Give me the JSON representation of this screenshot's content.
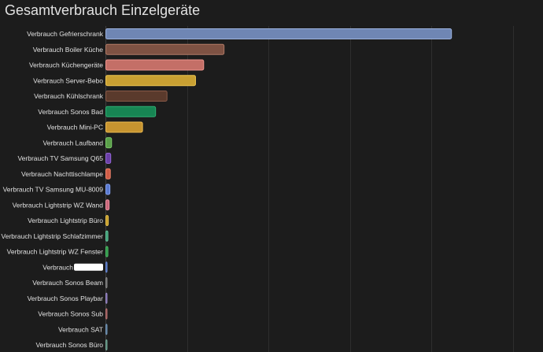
{
  "chart_data": {
    "type": "bar",
    "orientation": "horizontal",
    "title": "Gesamtverbrauch Einzelgeräte",
    "xlabel": "",
    "ylabel": "",
    "xlim": [
      0,
      53
    ],
    "grid": true,
    "legend": "none",
    "categories": [
      "Verbrauch Gefrierschrank",
      "Verbrauch Boiler Küche",
      "Verbrauch Küchengeräte",
      "Verbrauch Server-Bebo",
      "Verbrauch Kühlschrank",
      "Verbrauch Sonos Bad",
      "Verbrauch Mini-PC",
      "Verbrauch Laufband",
      "Verbrauch TV Samsung Q65",
      "Verbrauch Nachttischlampe",
      "Verbrauch TV Samsung MU-8009",
      "Verbrauch Lightstrip WZ Wand",
      "Verbrauch Lightstrip Büro",
      "Verbrauch Lightstrip Schlafzimmer",
      "Verbrauch Lightstrip WZ Fenster",
      "Verbrauch",
      "Verbrauch Sonos Beam",
      "Verbrauch Sonos Playbar",
      "Verbrauch Sonos Sub",
      "Verbrauch SAT",
      "Verbrauch Sonos Büro"
    ],
    "values": [
      42.4,
      14.5,
      12.0,
      11.0,
      7.5,
      6.1,
      4.5,
      0.7,
      0.6,
      0.55,
      0.5,
      0.4,
      0.3,
      0.25,
      0.25,
      0.15,
      0.12,
      0.1,
      0.1,
      0.1,
      0.08
    ],
    "redacted": [
      false,
      false,
      false,
      false,
      false,
      false,
      false,
      false,
      false,
      false,
      false,
      false,
      false,
      false,
      false,
      true,
      false,
      false,
      false,
      false,
      false
    ],
    "colors": [
      "#6f86b4",
      "#7e5243",
      "#c46f67",
      "#c9a032",
      "#5a3a2c",
      "#178553",
      "#c79430",
      "#5a9e4a",
      "#6b3fa6",
      "#cf5d47",
      "#5a7ad0",
      "#c8677a",
      "#c39a2a",
      "#3e9a74",
      "#2f9447",
      "#3f5fa8",
      "#5b5b5b",
      "#6a5a9a",
      "#8a4a4a",
      "#4a6a8a",
      "#4a7a6a"
    ],
    "border_colors": [
      "#9bb1dd",
      "#b07a66",
      "#f0968e",
      "#eec650",
      "#8a5a48",
      "#2fb074",
      "#eebb4f",
      "#7ccb6a",
      "#9366d6",
      "#f0846c",
      "#86a2f2",
      "#ee92a4",
      "#e8c450",
      "#64c49c",
      "#4cbc66",
      "#6a8ad6",
      "#888888",
      "#9a8ac6",
      "#b67272",
      "#7496b6",
      "#74a696"
    ]
  }
}
